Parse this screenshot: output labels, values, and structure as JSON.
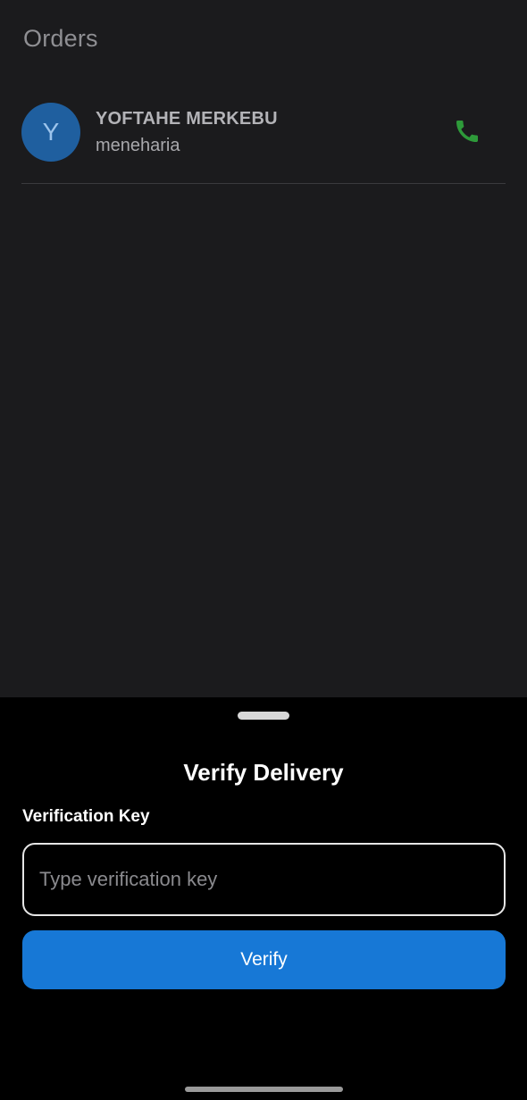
{
  "header": {
    "title": "Orders"
  },
  "orders": [
    {
      "avatar_initial": "Y",
      "name": "YOFTAHE MERKEBU",
      "subtitle": "meneharia",
      "action_icon": "phone-icon"
    }
  ],
  "sheet": {
    "title": "Verify Delivery",
    "field_label": "Verification Key",
    "input_value": "",
    "input_placeholder": "Type verification key",
    "button_label": "Verify"
  },
  "colors": {
    "background": "#1b1b1d",
    "sheet_background": "#000000",
    "avatar": "#1f5f9f",
    "phone_icon": "#2e9a3a",
    "primary_button": "#1778d6"
  }
}
